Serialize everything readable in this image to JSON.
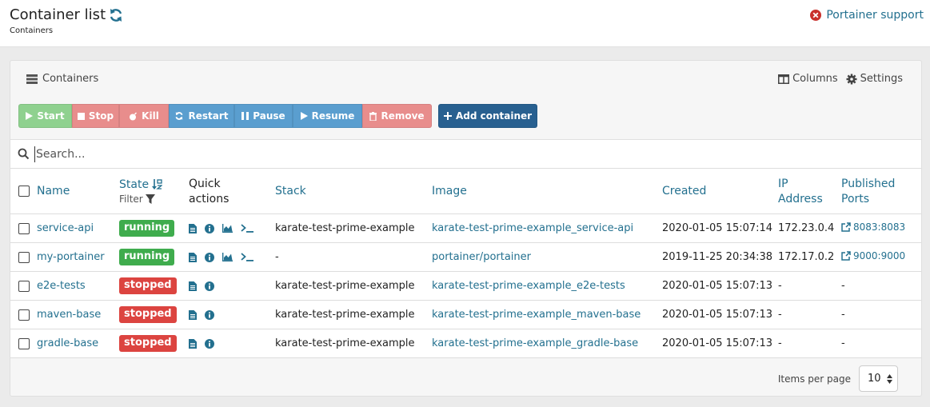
{
  "header": {
    "title": "Container list",
    "breadcrumb": "Containers",
    "support_label": "Portainer support"
  },
  "panel": {
    "title": "Containers",
    "columns_label": "Columns",
    "settings_label": "Settings"
  },
  "actions": {
    "start": "Start",
    "stop": "Stop",
    "kill": "Kill",
    "restart": "Restart",
    "pause": "Pause",
    "resume": "Resume",
    "remove": "Remove",
    "add": "Add container"
  },
  "search": {
    "placeholder": "Search..."
  },
  "columns": {
    "name": "Name",
    "state": "State",
    "state_filter": "Filter",
    "quick_actions_1": "Quick",
    "quick_actions_2": "actions",
    "stack": "Stack",
    "image": "Image",
    "created": "Created",
    "ip_1": "IP",
    "ip_2": "Address",
    "ports_1": "Published",
    "ports_2": "Ports"
  },
  "rows": [
    {
      "name": "service-api",
      "state": "running",
      "stack": "karate-test-prime-example",
      "image": "karate-test-prime-example_service-api",
      "created": "2020-01-05 15:07:14",
      "ip": "172.23.0.4",
      "port": "8083:8083"
    },
    {
      "name": "my-portainer",
      "state": "running",
      "stack": "-",
      "image": "portainer/portainer",
      "created": "2019-11-25 20:34:38",
      "ip": "172.17.0.2",
      "port": "9000:9000"
    },
    {
      "name": "e2e-tests",
      "state": "stopped",
      "stack": "karate-test-prime-example",
      "image": "karate-test-prime-example_e2e-tests",
      "created": "2020-01-05 15:07:13",
      "ip": "-",
      "port": "-"
    },
    {
      "name": "maven-base",
      "state": "stopped",
      "stack": "karate-test-prime-example",
      "image": "karate-test-prime-example_maven-base",
      "created": "2020-01-05 15:07:13",
      "ip": "-",
      "port": "-"
    },
    {
      "name": "gradle-base",
      "state": "stopped",
      "stack": "karate-test-prime-example",
      "image": "karate-test-prime-example_gradle-base",
      "created": "2020-01-05 15:07:13",
      "ip": "-",
      "port": "-"
    }
  ],
  "footer": {
    "items_per_page_label": "Items per page",
    "items_per_page_value": "10"
  },
  "colors": {
    "link": "#23708f",
    "running": "#3fac4d",
    "stopped": "#dc4440",
    "primary": "#286090"
  }
}
